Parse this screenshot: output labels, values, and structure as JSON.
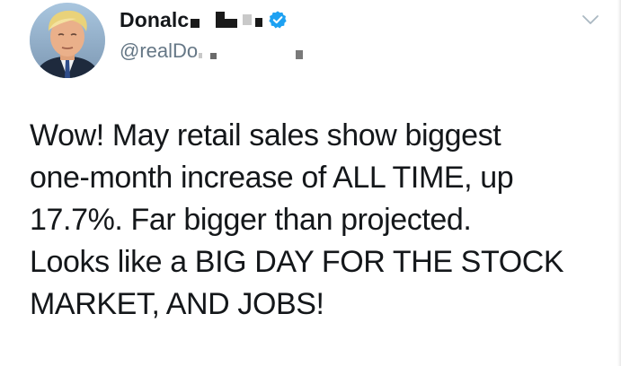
{
  "author": {
    "display_name_visible": "Donalc",
    "handle_visible": "@realDo",
    "avatar_icon": "profile-photo",
    "verified_icon": "verified-badge-icon",
    "verified_color": "#1da1f2"
  },
  "tweet": {
    "lines": [
      "Wow! May retail sales show biggest",
      "one-month increase of ALL TIME, up",
      "17.7%. Far bigger than projected.",
      "Looks like a BIG DAY FOR THE STOCK",
      "MARKET, AND JOBS!"
    ]
  },
  "menu": {
    "caret_icon": "chevron-down-icon"
  }
}
